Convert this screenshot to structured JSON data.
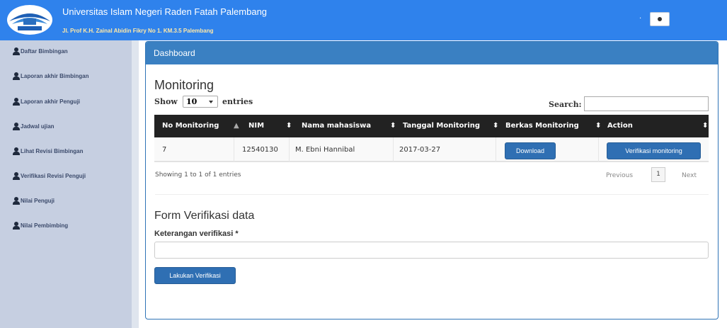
{
  "header": {
    "university": "Universitas Islam Negeri Raden Fatah Palembang",
    "address": "Jl. Prof K.H. Zainal Abidin Fikry No 1. KM.3.5 Palembang",
    "dot": "·"
  },
  "sidebar": {
    "items": [
      {
        "label": "Daftar Bimbingan"
      },
      {
        "label": "Laporan akhir Bimbingan"
      },
      {
        "label": "Laporan akhir Penguji"
      },
      {
        "label": "Jadwal ujian"
      },
      {
        "label": "Lihat Revisi Bimbingan"
      },
      {
        "label": "Verifikasi Revisi Penguji"
      },
      {
        "label": "Nilai Penguji"
      },
      {
        "label": "Nilai Pembimbing"
      }
    ]
  },
  "card": {
    "title": "Dashboard"
  },
  "monitoring": {
    "title": "Monitoring",
    "show_label": "Show",
    "entries_value": "10",
    "entries_label": "entries",
    "search_label": "Search:",
    "search_value": ""
  },
  "table": {
    "columns": [
      "No Monitoring",
      "NIM",
      "Nama mahasiswa",
      "Tanggal Monitoring",
      "Berkas Monitoring",
      "Action"
    ],
    "rows": [
      {
        "no": "7",
        "nim": "12540130",
        "nama": "M. Ebni Hannibal",
        "tanggal": "2017-03-27",
        "berkas_button": "Download",
        "action_button": "Verifikasi monitoring"
      }
    ],
    "info": "Showing 1 to 1 of 1 entries",
    "pagination": {
      "previous": "Previous",
      "page": "1",
      "next": "Next"
    }
  },
  "form": {
    "title": "Form Verifikasi data",
    "field_label": "Keterangan verifikasi *",
    "field_value": "",
    "submit_label": "Lakukan Verifikasi"
  }
}
